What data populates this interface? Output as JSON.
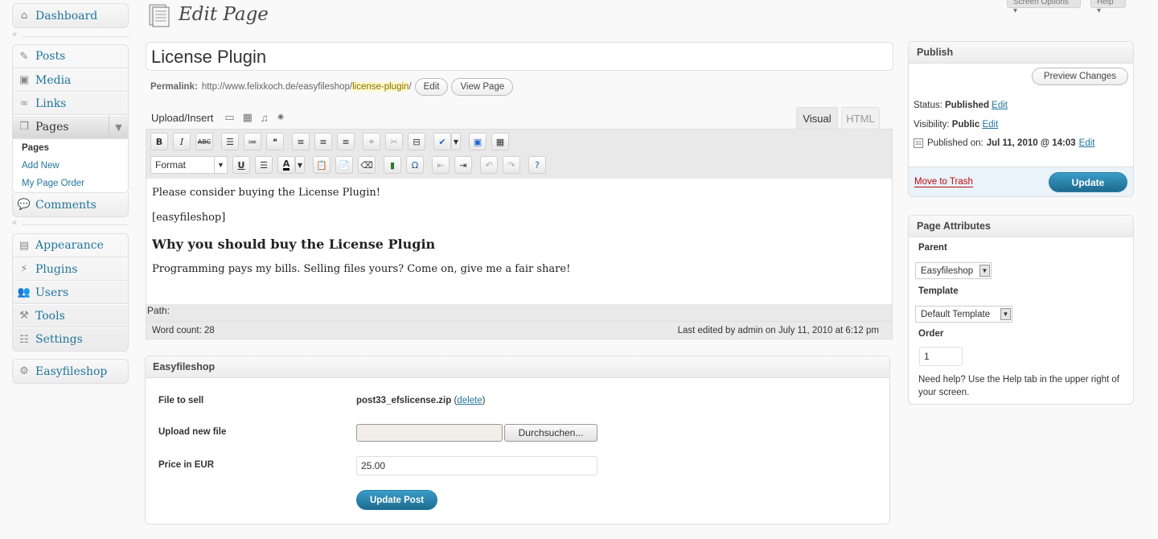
{
  "header": {
    "title": "Edit Page",
    "screen_options": "Screen Options ▾",
    "help": "Help ▾"
  },
  "sidebar": {
    "dashboard": "Dashboard",
    "group1": [
      "Posts",
      "Media",
      "Links",
      "Pages"
    ],
    "pages_sub": [
      "Pages",
      "Add New",
      "My Page Order"
    ],
    "comments": "Comments",
    "group2": [
      "Appearance",
      "Plugins",
      "Users",
      "Tools",
      "Settings"
    ],
    "plugin": "Easyfileshop"
  },
  "post": {
    "title": "License Plugin",
    "permalink_label": "Permalink:",
    "permalink_base": "http://www.felixkoch.de/easyfileshop/",
    "permalink_slug": "license-plugin",
    "permalink_end": "/",
    "edit_btn": "Edit",
    "view_btn": "View Page"
  },
  "editor": {
    "upload_label": "Upload/Insert",
    "tab_visual": "Visual",
    "tab_html": "HTML",
    "format": "Format",
    "p1": "Please consider buying the License Plugin!",
    "p2": "[easyfileshop]",
    "h3": "Why you should buy the License Plugin",
    "p3": "Programming pays my bills. Selling files yours? Come on, give me a fair share!",
    "path": "Path:",
    "word_count": "Word count: 28",
    "last_edited": "Last edited by admin on July 11, 2010 at 6:12 pm"
  },
  "easyfileshop": {
    "title": "Easyfileshop",
    "file_label": "File to sell",
    "file_name": "post33_efslicense.zip",
    "delete_open": "(",
    "delete_link": "delete",
    "delete_close": ")",
    "upload_label": "Upload new file",
    "browse_btn": "Durchsuchen...",
    "price_label": "Price in EUR",
    "price_value": "25.00",
    "update_btn": "Update Post"
  },
  "publish": {
    "title": "Publish",
    "preview_btn": "Preview Changes",
    "status_label": "Status:",
    "status_value": "Published",
    "visibility_label": "Visibility:",
    "visibility_value": "Public",
    "published_label": "Published on:",
    "published_value": "Jul 11, 2010 @ 14:03",
    "edit": "Edit",
    "trash": "Move to Trash",
    "update_btn": "Update"
  },
  "attributes": {
    "title": "Page Attributes",
    "parent_label": "Parent",
    "parent_value": "Easyfileshop",
    "template_label": "Template",
    "template_value": "Default Template",
    "order_label": "Order",
    "order_value": "1",
    "help_text": "Need help? Use the Help tab in the upper right of your screen."
  }
}
